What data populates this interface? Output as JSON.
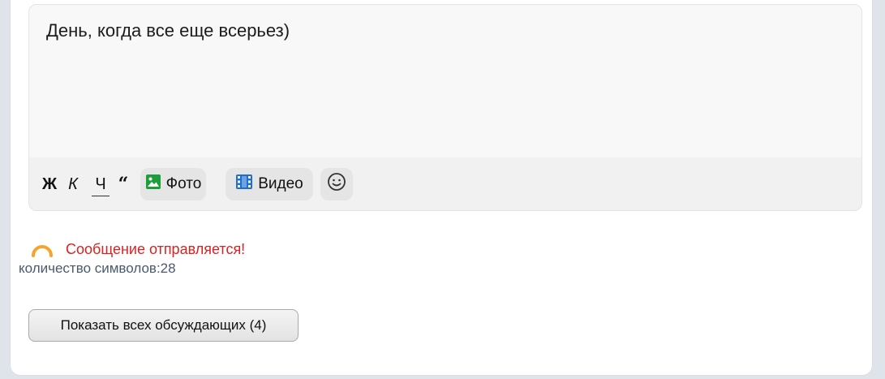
{
  "editor": {
    "text": "День, когда все еще всерьез)",
    "toolbar": {
      "bold_label": "Ж",
      "italic_label": "К",
      "underline_label": "Ч",
      "quote_label": "“",
      "photo_label": "Фото",
      "video_label": "Видео",
      "photo_icon_color": "#1e9e3a",
      "video_icon_color": "#1f6fd1"
    }
  },
  "status": {
    "message": "Сообщение отправляется!",
    "message_color": "#e02020",
    "spinner_color": "#f3a62b"
  },
  "char_count": {
    "text": "количество символов:28"
  },
  "show_participants": {
    "label": "Показать всех обсуждающих (4)"
  }
}
